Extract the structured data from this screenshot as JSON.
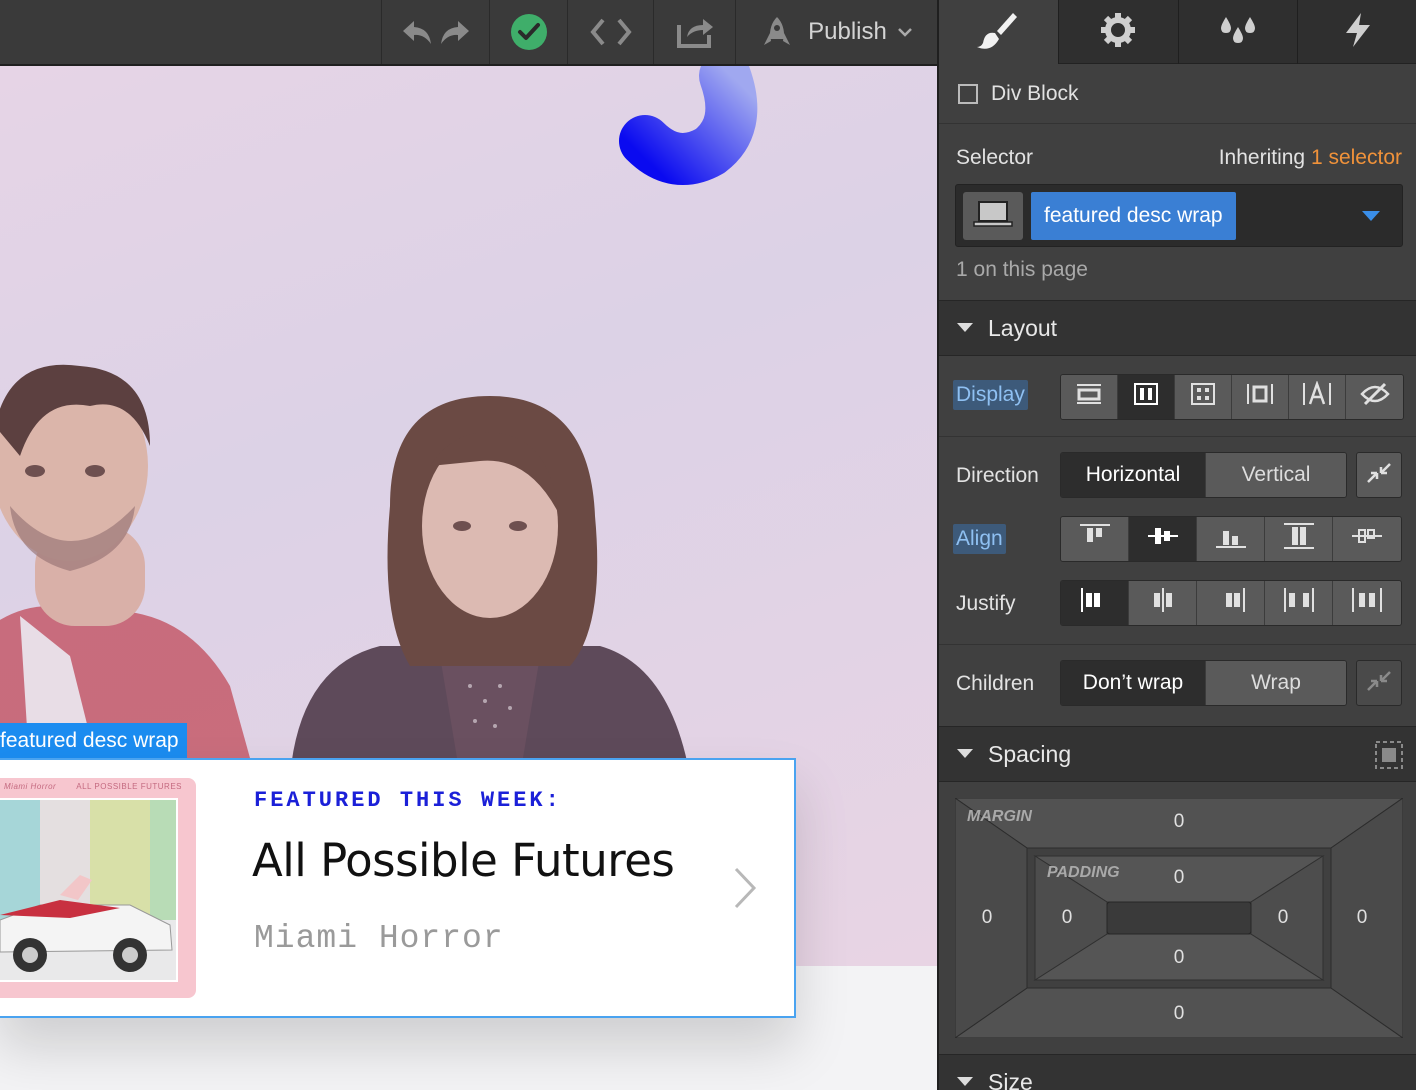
{
  "toolbar": {
    "publish_label": "Publish"
  },
  "canvas": {
    "selected_label": "featured desc wrap",
    "card": {
      "kicker": "FEATURED THIS WEEK:",
      "title": "All Possible Futures",
      "artist": "Miami Horror",
      "album_art_left_text": "Miami Horror",
      "album_art_right_text": "ALL POSSIBLE FUTURES"
    }
  },
  "panel": {
    "tabs": [
      {
        "name": "style",
        "icon": "paintbrush-icon",
        "active": true
      },
      {
        "name": "settings",
        "icon": "gear-icon",
        "active": false
      },
      {
        "name": "style-manager",
        "icon": "droplets-icon",
        "active": false
      },
      {
        "name": "interactions",
        "icon": "lightning-icon",
        "active": false
      }
    ],
    "element_type": "Div Block",
    "selector": {
      "label": "Selector",
      "inheriting_prefix": "Inheriting",
      "inheriting_link": "1 selector",
      "class_tag": "featured desc wrap",
      "count_text": "1 on this page"
    },
    "layout": {
      "title": "Layout",
      "display_label": "Display",
      "direction_label": "Direction",
      "direction_options": [
        "Horizontal",
        "Vertical"
      ],
      "align_label": "Align",
      "justify_label": "Justify",
      "children_label": "Children",
      "children_options": [
        "Don’t wrap",
        "Wrap"
      ]
    },
    "spacing": {
      "title": "Spacing",
      "margin_label": "MARGIN",
      "padding_label": "PADDING",
      "margin": {
        "top": "0",
        "right": "0",
        "bottom": "0",
        "left": "0"
      },
      "padding": {
        "top": "0",
        "right": "0",
        "bottom": "0",
        "left": "0"
      }
    },
    "size": {
      "title": "Size"
    }
  },
  "colors": {
    "accent_blue": "#3a7fd4",
    "orange_link": "#f0923a",
    "kicker_blue": "#1b20d8",
    "check_green": "#3fae6a"
  }
}
